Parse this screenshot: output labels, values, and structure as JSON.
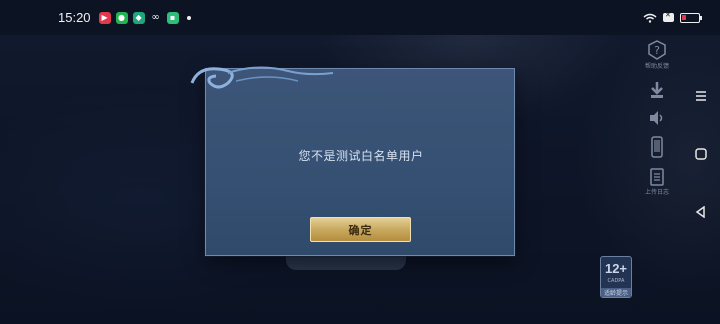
{
  "status_bar": {
    "time": "15:20",
    "notification_icons": [
      "video-app-icon",
      "wechat-icon",
      "shield-app-icon",
      "link-icon",
      "chat-app-icon"
    ]
  },
  "side_tools": {
    "help_label": "帮助反馈",
    "download_label": "",
    "volume_label": "",
    "phone_label": "",
    "upload_label": "上传日志"
  },
  "age_badge": {
    "rating": "12+",
    "sub": "CADPA",
    "foot": "适龄提示"
  },
  "dialog": {
    "message": "您不是测试白名单用户",
    "confirm_label": "确定"
  },
  "colors": {
    "dialog_bg": "#3c5578",
    "button_gold": "#c9a95e",
    "text_light": "#d7e1f2"
  }
}
